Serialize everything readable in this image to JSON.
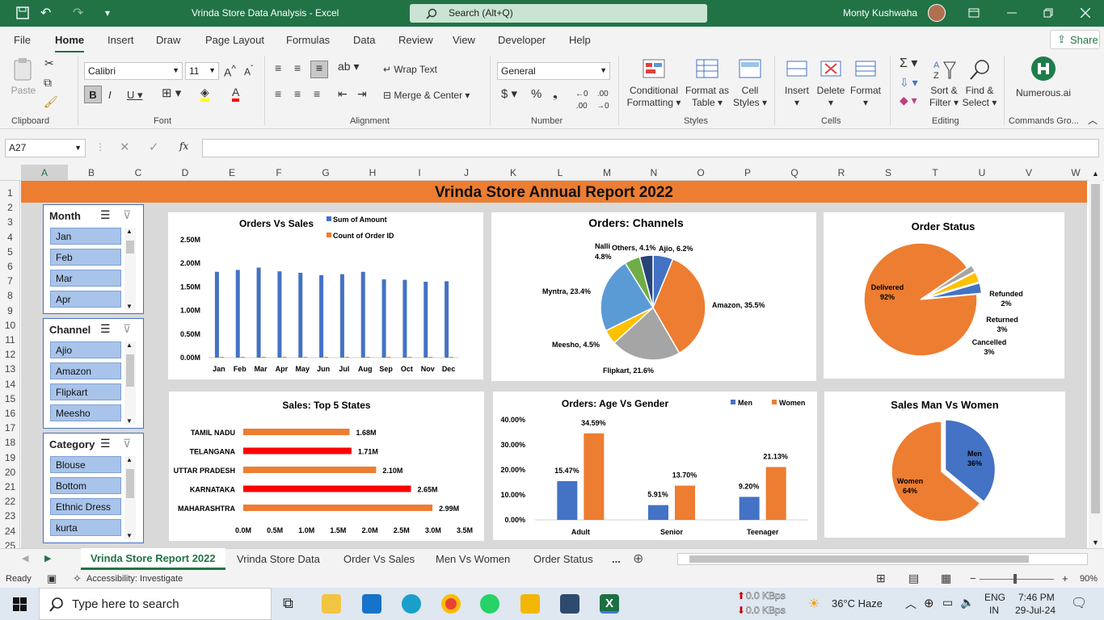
{
  "titlebar": {
    "doc_title": "Vrinda Store Data Analysis - Excel",
    "search_placeholder": "Search (Alt+Q)",
    "user": "Monty Kushwaha"
  },
  "menu": [
    "File",
    "Home",
    "Insert",
    "Draw",
    "Page Layout",
    "Formulas",
    "Data",
    "Review",
    "View",
    "Developer",
    "Help"
  ],
  "share_label": "Share",
  "ribbon": {
    "paste": "Paste",
    "font_name": "Calibri",
    "font_size": "11",
    "wrap_text": "Wrap Text",
    "merge_center": "Merge & Center",
    "number_format": "General",
    "cond_format": [
      "Conditional",
      "Formatting"
    ],
    "format_table": [
      "Format as",
      "Table"
    ],
    "cell_styles": [
      "Cell",
      "Styles"
    ],
    "insert": "Insert",
    "delete": "Delete",
    "format": "Format",
    "sort_filter": [
      "Sort &",
      "Filter"
    ],
    "find_select": [
      "Find &",
      "Select"
    ],
    "numerous": "Numerous.ai",
    "groups": [
      "Clipboard",
      "Font",
      "Alignment",
      "Number",
      "Styles",
      "Cells",
      "Editing",
      "Commands Gro..."
    ]
  },
  "formula_bar": {
    "name_box": "A27",
    "fx": "fx",
    "value": ""
  },
  "columns": [
    "A",
    "B",
    "C",
    "D",
    "E",
    "F",
    "G",
    "H",
    "I",
    "J",
    "K",
    "L",
    "M",
    "N",
    "O",
    "P",
    "Q",
    "R",
    "S",
    "T",
    "U",
    "V",
    "W"
  ],
  "rows": [
    "1",
    "2",
    "3",
    "4",
    "5",
    "6",
    "7",
    "8",
    "9",
    "10",
    "11",
    "12",
    "13",
    "14",
    "15",
    "16",
    "17",
    "18",
    "19",
    "20",
    "21",
    "22",
    "23",
    "24",
    "25"
  ],
  "report_title": "Vrinda Store Annual Report 2022",
  "slicers": {
    "month": {
      "title": "Month",
      "items": [
        "Jan",
        "Feb",
        "Mar",
        "Apr"
      ]
    },
    "channel": {
      "title": "Channel",
      "items": [
        "Ajio",
        "Amazon",
        "Flipkart",
        "Meesho"
      ]
    },
    "category": {
      "title": "Category",
      "items": [
        "Blouse",
        "Bottom",
        "Ethnic Dress",
        "kurta"
      ]
    }
  },
  "chart_data": [
    {
      "type": "bar",
      "title": "Orders Vs Sales",
      "categories": [
        "Jan",
        "Feb",
        "Mar",
        "Apr",
        "May",
        "Jun",
        "Jul",
        "Aug",
        "Sep",
        "Oct",
        "Nov",
        "Dec"
      ],
      "series": [
        {
          "name": "Sum of Amount",
          "values": [
            1.82,
            1.86,
            1.91,
            1.83,
            1.8,
            1.75,
            1.77,
            1.82,
            1.66,
            1.65,
            1.61,
            1.62
          ]
        },
        {
          "name": "Count of Order ID",
          "values": [
            0.01,
            0.01,
            0.01,
            0.01,
            0.01,
            0.01,
            0.01,
            0.01,
            0.01,
            0.01,
            0.01,
            0.01
          ]
        }
      ],
      "yticks": [
        "0.00M",
        "0.50M",
        "1.00M",
        "1.50M",
        "2.00M",
        "2.50M"
      ],
      "ylim": [
        0,
        2.5
      ],
      "colors": [
        "#4472c4",
        "#ed7d31"
      ],
      "legend": "top"
    },
    {
      "type": "pie",
      "title": "Orders: Channels",
      "slices": [
        {
          "label": "Ajio, 6.2%",
          "value": 6.2,
          "color": "#4472c4"
        },
        {
          "label": "Amazon, 35.5%",
          "value": 35.5,
          "color": "#ed7d31"
        },
        {
          "label": "Flipkart, 21.6%",
          "value": 21.6,
          "color": "#a5a5a5"
        },
        {
          "label": "Meesho, 4.5%",
          "value": 4.5,
          "color": "#ffc000"
        },
        {
          "label": "Myntra, 23.4%",
          "value": 23.4,
          "color": "#5b9bd5"
        },
        {
          "label": "Nalli, 4.8%",
          "value": 4.8,
          "color": "#70ad47"
        },
        {
          "label": "Others, 4.1%",
          "value": 4.1,
          "color": "#264478"
        }
      ]
    },
    {
      "type": "pie",
      "title": "Order Status",
      "slices": [
        {
          "label": "Delivered",
          "pct": "92%",
          "value": 92,
          "color": "#ed7d31"
        },
        {
          "label": "Refunded",
          "pct": "2%",
          "value": 2,
          "color": "#a5a5a5"
        },
        {
          "label": "Returned",
          "pct": "3%",
          "value": 3,
          "color": "#ffc000"
        },
        {
          "label": "Cancelled",
          "pct": "3%",
          "value": 3,
          "color": "#4472c4"
        }
      ]
    },
    {
      "type": "bar",
      "orientation": "horizontal",
      "title": "Sales: Top 5 States",
      "categories": [
        "TAMIL NADU",
        "TELANGANA",
        "UTTAR PRADESH",
        "KARNATAKA",
        "MAHARASHTRA"
      ],
      "values": [
        1.68,
        1.71,
        2.1,
        2.65,
        2.99
      ],
      "value_labels": [
        "1.68M",
        "1.71M",
        "2.10M",
        "2.65M",
        "2.99M"
      ],
      "colors": [
        "#ed7d31",
        "#ff0000",
        "#ed7d31",
        "#ff0000",
        "#ed7d31"
      ],
      "xticks": [
        "0.0M",
        "0.5M",
        "1.0M",
        "1.5M",
        "2.0M",
        "2.5M",
        "3.0M",
        "3.5M"
      ],
      "xlim": [
        0,
        3.5
      ]
    },
    {
      "type": "bar",
      "title": "Orders: Age Vs Gender",
      "categories": [
        "Adult",
        "Senior",
        "Teenager"
      ],
      "series": [
        {
          "name": "Men",
          "values": [
            15.47,
            5.91,
            9.2
          ],
          "labels": [
            "15.47%",
            "5.91%",
            "9.20%"
          ]
        },
        {
          "name": "Women",
          "values": [
            34.59,
            13.7,
            21.13
          ],
          "labels": [
            "34.59%",
            "13.70%",
            "21.13%"
          ]
        }
      ],
      "yticks": [
        "0.00%",
        "10.00%",
        "20.00%",
        "30.00%",
        "40.00%"
      ],
      "ylim": [
        0,
        40
      ],
      "colors": [
        "#4472c4",
        "#ed7d31"
      ],
      "legend": "top-right"
    },
    {
      "type": "pie",
      "title": "Sales Man Vs Women",
      "slices": [
        {
          "label": "Men",
          "pct": "36%",
          "value": 36,
          "color": "#4472c4"
        },
        {
          "label": "Women",
          "pct": "64%",
          "value": 64,
          "color": "#ed7d31"
        }
      ]
    }
  ],
  "sheet_tabs": [
    "Vrinda Store Report 2022",
    "Vrinda Store Data",
    "Order Vs Sales",
    "Men Vs Women",
    "Order Status",
    "..."
  ],
  "status": {
    "ready": "Ready",
    "accessibility": "Accessibility: Investigate",
    "zoom": "90%"
  },
  "taskbar": {
    "search": "Type here to search",
    "net_up": "0.0 KBps",
    "net_down": "0.0 KBps",
    "weather": "36°C  Haze",
    "lang1": "ENG",
    "lang2": "IN",
    "time": "7:46 PM",
    "date": "29-Jul-24"
  }
}
